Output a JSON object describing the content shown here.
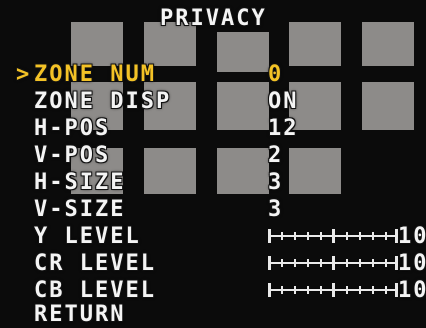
{
  "menu": {
    "title": "PRIVACY",
    "cursor": ">",
    "items": [
      {
        "label": "ZONE NUM",
        "value": "0"
      },
      {
        "label": "ZONE DISP",
        "value": "ON"
      },
      {
        "label": "H-POS",
        "value": "12"
      },
      {
        "label": "V-POS",
        "value": "2"
      },
      {
        "label": "H-SIZE",
        "value": "3"
      },
      {
        "label": "V-SIZE",
        "value": "3"
      },
      {
        "label": "Y LEVEL",
        "value": "10"
      },
      {
        "label": "CR LEVEL",
        "value": "10"
      },
      {
        "label": "CB LEVEL",
        "value": "10"
      },
      {
        "label": "RETURN",
        "value": ""
      }
    ],
    "selected_index": 0
  },
  "colors": {
    "selected": "#f3c226",
    "text": "#f4f4f4",
    "mask": "#a4a2a0",
    "background": "#0b0b0b"
  }
}
